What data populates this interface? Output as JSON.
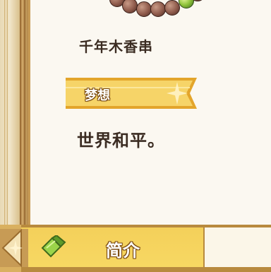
{
  "item": {
    "name": "千年木香串",
    "icon": "bead-bracelet-icon"
  },
  "dream": {
    "header": "梦想",
    "text": "世界和平。"
  },
  "tabs": [
    {
      "label": "简介",
      "icon": "leaf-icon",
      "selected": true
    }
  ],
  "colors": {
    "accent": "#f5cf58",
    "text": "#3b2c22",
    "panel": "#fbf8f1"
  }
}
